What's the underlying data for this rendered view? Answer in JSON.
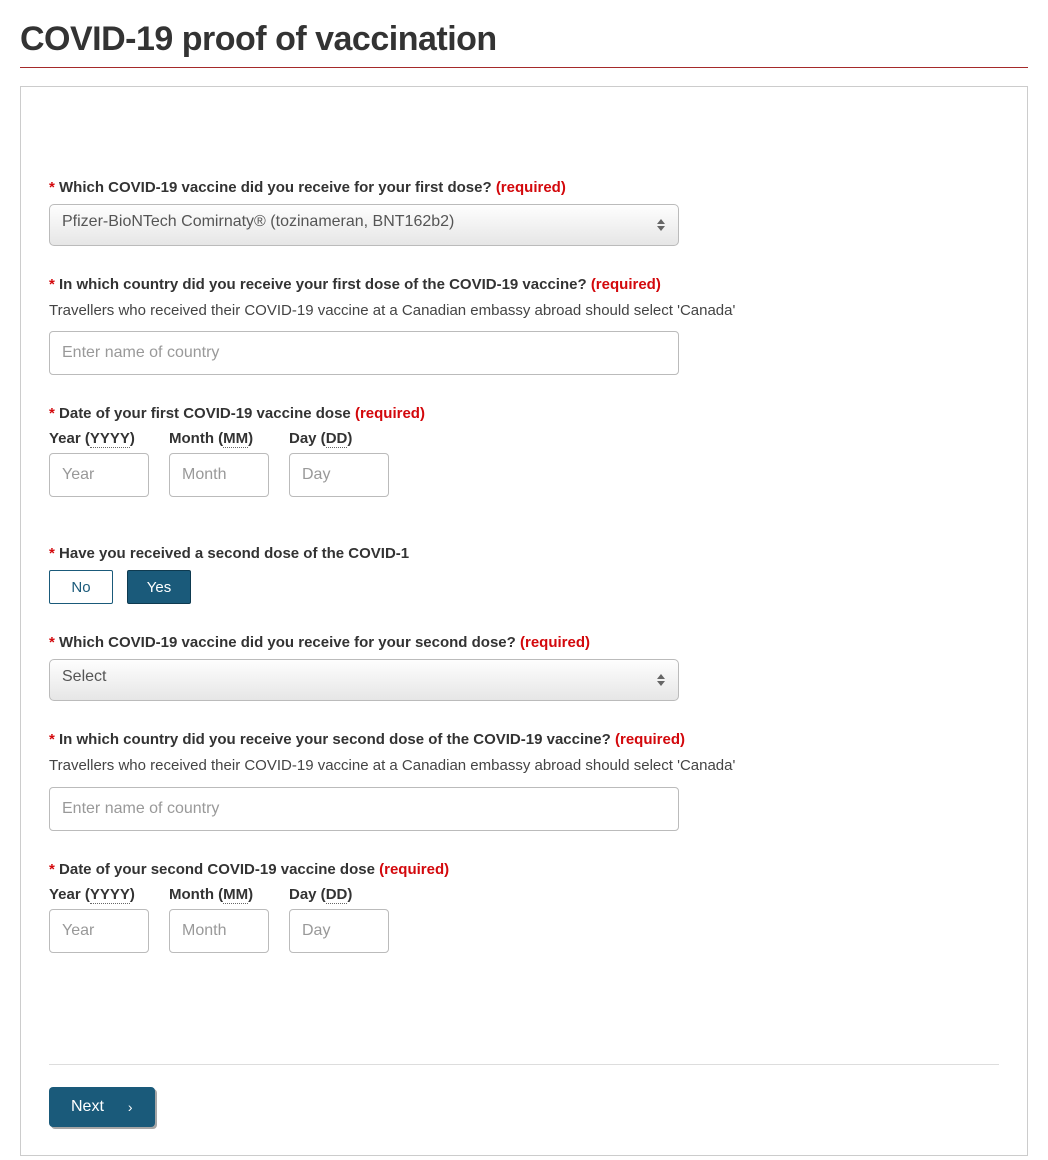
{
  "page": {
    "title": "COVID-19 proof of vaccination"
  },
  "common": {
    "required_star": "*",
    "required_text": "(required)"
  },
  "dose1": {
    "vaccine_label": "Which COVID-19 vaccine did you receive for your first dose?",
    "vaccine_selected": "Pfizer-BioNTech Comirnaty® (tozinameran, BNT162b2)",
    "country_label": "In which country did you receive your first dose of the COVID-19 vaccine?",
    "country_hint": "Travellers who received their COVID-19 vaccine at a Canadian embassy abroad should select 'Canada'",
    "country_placeholder": "Enter name of country",
    "date_label": "Date of your first COVID-19 vaccine dose",
    "year_label_prefix": "Year (",
    "year_abbr": "YYYY",
    "year_label_suffix": ")",
    "month_label_prefix": "Month (",
    "month_abbr": "MM",
    "month_label_suffix": ")",
    "day_label_prefix": "Day (",
    "day_abbr": "DD",
    "day_label_suffix": ")",
    "year_placeholder": "Year",
    "month_placeholder": "Month",
    "day_placeholder": "Day"
  },
  "dose2": {
    "has_second_label": "Have you received a second dose of the COVID-1",
    "no_label": "No",
    "yes_label": "Yes",
    "vaccine_label": "Which COVID-19 vaccine did you receive for your second dose?",
    "vaccine_selected": "Select",
    "country_label": "In which country did you receive your second dose of the COVID-19 vaccine?",
    "country_hint": "Travellers who received their COVID-19 vaccine at a Canadian embassy abroad should select 'Canada'",
    "country_placeholder": "Enter name of country",
    "date_label": "Date of your second COVID-19 vaccine dose",
    "year_label_prefix": "Year (",
    "year_abbr": "YYYY",
    "year_label_suffix": ")",
    "month_label_prefix": "Month (",
    "month_abbr": "MM",
    "month_label_suffix": ")",
    "day_label_prefix": "Day (",
    "day_abbr": "DD",
    "day_label_suffix": ")",
    "year_placeholder": "Year",
    "month_placeholder": "Month",
    "day_placeholder": "Day"
  },
  "footer": {
    "next_label": "Next",
    "next_arrow": "›"
  }
}
